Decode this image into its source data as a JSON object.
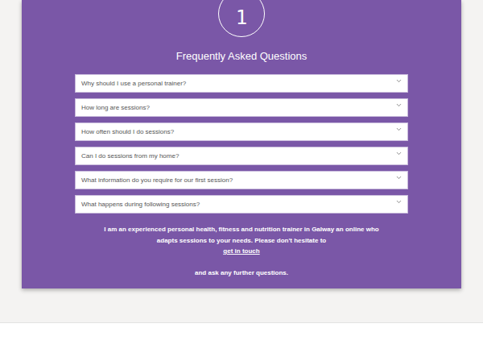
{
  "badge": "1",
  "title": "Frequently Asked Questions",
  "faq": [
    {
      "question": "Why should I use a personal trainer?",
      "expanded": false
    },
    {
      "question": "How long are sessions?",
      "expanded": false
    },
    {
      "question": "How often should I do sessions?",
      "expanded": false
    },
    {
      "question": "Can I do sessions from my home?",
      "expanded": false
    },
    {
      "question": "What information do you require for our first session?",
      "expanded": false
    },
    {
      "question": "What happens during following sessions?",
      "expanded": false
    }
  ],
  "contact": {
    "text": "I am an experienced personal health, fitness and nutrition trainer in Galway an online who adapts sessions to your needs. Please don't hesitate to",
    "link": "get in touch",
    "outro": "and ask any further questions."
  }
}
